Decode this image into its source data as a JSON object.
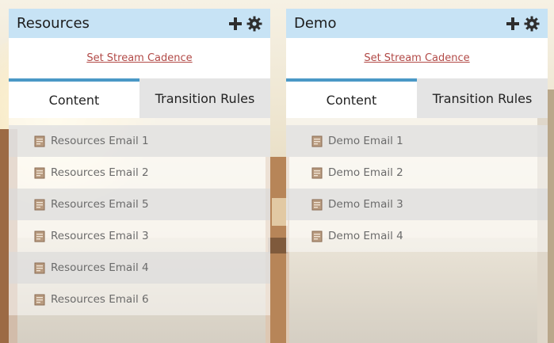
{
  "panels": [
    {
      "title": "Resources",
      "cadence_link": "Set Stream Cadence",
      "tabs": [
        "Content",
        "Transition Rules"
      ],
      "active_tab": "Content",
      "items": [
        "Resources Email 1",
        "Resources Email 2",
        "Resources Email 5",
        "Resources Email 3",
        "Resources Email 4",
        "Resources Email 6"
      ]
    },
    {
      "title": "Demo",
      "cadence_link": "Set Stream Cadence",
      "tabs": [
        "Content",
        "Transition Rules"
      ],
      "active_tab": "Content",
      "items": [
        "Demo Email 1",
        "Demo Email 2",
        "Demo Email 3",
        "Demo Email 4"
      ]
    }
  ],
  "icons": {
    "add": "plus-icon",
    "settings": "gear-icon",
    "item": "email-icon"
  },
  "colors": {
    "header": "#c7e3f5",
    "tab_accent": "#4a98c6",
    "link": "#b24a47"
  }
}
